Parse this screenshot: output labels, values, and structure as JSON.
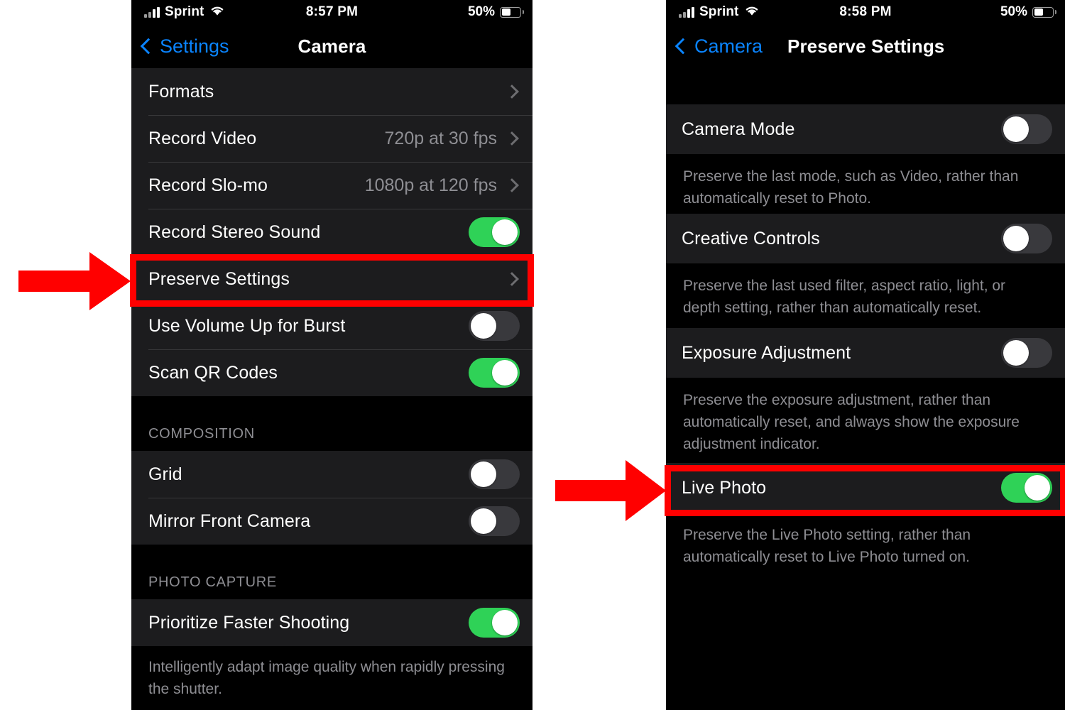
{
  "accent_blue": "#0a84ff",
  "toggle_on_color": "#2fd257",
  "highlight_color": "#ff0000",
  "left_phone": {
    "status_bar": {
      "carrier": "Sprint",
      "time": "8:57 PM",
      "battery_percent": "50%",
      "signal_icon": "cellular-signal-icon",
      "wifi_icon": "wifi-icon",
      "battery_icon": "battery-icon"
    },
    "nav": {
      "back_label": "Settings",
      "title": "Camera"
    },
    "groups": [
      {
        "header": "",
        "rows": [
          {
            "label": "Formats",
            "value": "",
            "accessory": "chevron"
          },
          {
            "label": "Record Video",
            "value": "720p at 30 fps",
            "accessory": "chevron"
          },
          {
            "label": "Record Slo-mo",
            "value": "1080p at 120 fps",
            "accessory": "chevron"
          },
          {
            "label": "Record Stereo Sound",
            "value": "",
            "accessory": "toggle",
            "toggle_on": true
          },
          {
            "label": "Preserve Settings",
            "value": "",
            "accessory": "chevron",
            "highlighted": true
          },
          {
            "label": "Use Volume Up for Burst",
            "value": "",
            "accessory": "toggle",
            "toggle_on": false
          },
          {
            "label": "Scan QR Codes",
            "value": "",
            "accessory": "toggle",
            "toggle_on": true
          }
        ]
      },
      {
        "header": "COMPOSITION",
        "rows": [
          {
            "label": "Grid",
            "value": "",
            "accessory": "toggle",
            "toggle_on": false
          },
          {
            "label": "Mirror Front Camera",
            "value": "",
            "accessory": "toggle",
            "toggle_on": false
          }
        ]
      },
      {
        "header": "PHOTO CAPTURE",
        "rows": [
          {
            "label": "Prioritize Faster Shooting",
            "value": "",
            "accessory": "toggle",
            "toggle_on": true
          }
        ],
        "footer": "Intelligently adapt image quality when rapidly pressing the shutter."
      }
    ]
  },
  "right_phone": {
    "status_bar": {
      "carrier": "Sprint",
      "time": "8:58 PM",
      "battery_percent": "50%",
      "signal_icon": "cellular-signal-icon",
      "wifi_icon": "wifi-icon",
      "battery_icon": "battery-icon"
    },
    "nav": {
      "back_label": "Camera",
      "title": "Preserve Settings"
    },
    "items": [
      {
        "label": "Camera Mode",
        "toggle_on": false,
        "description": "Preserve the last mode, such as Video, rather than automatically reset to Photo."
      },
      {
        "label": "Creative Controls",
        "toggle_on": false,
        "description": "Preserve the last used filter, aspect ratio, light, or depth setting, rather than automatically reset."
      },
      {
        "label": "Exposure Adjustment",
        "toggle_on": false,
        "description": "Preserve the exposure adjustment, rather than automatically reset, and always show the exposure adjustment indicator."
      },
      {
        "label": "Live Photo",
        "toggle_on": true,
        "highlighted": true,
        "description": "Preserve the Live Photo setting, rather than automatically reset to Live Photo turned on."
      }
    ]
  },
  "annotations": {
    "arrow_left": "red-arrow-pointing-to-preserve-settings",
    "arrow_right": "red-arrow-pointing-to-live-photo",
    "box_left": "red-highlight-box-preserve-settings",
    "box_right": "red-highlight-box-live-photo"
  }
}
